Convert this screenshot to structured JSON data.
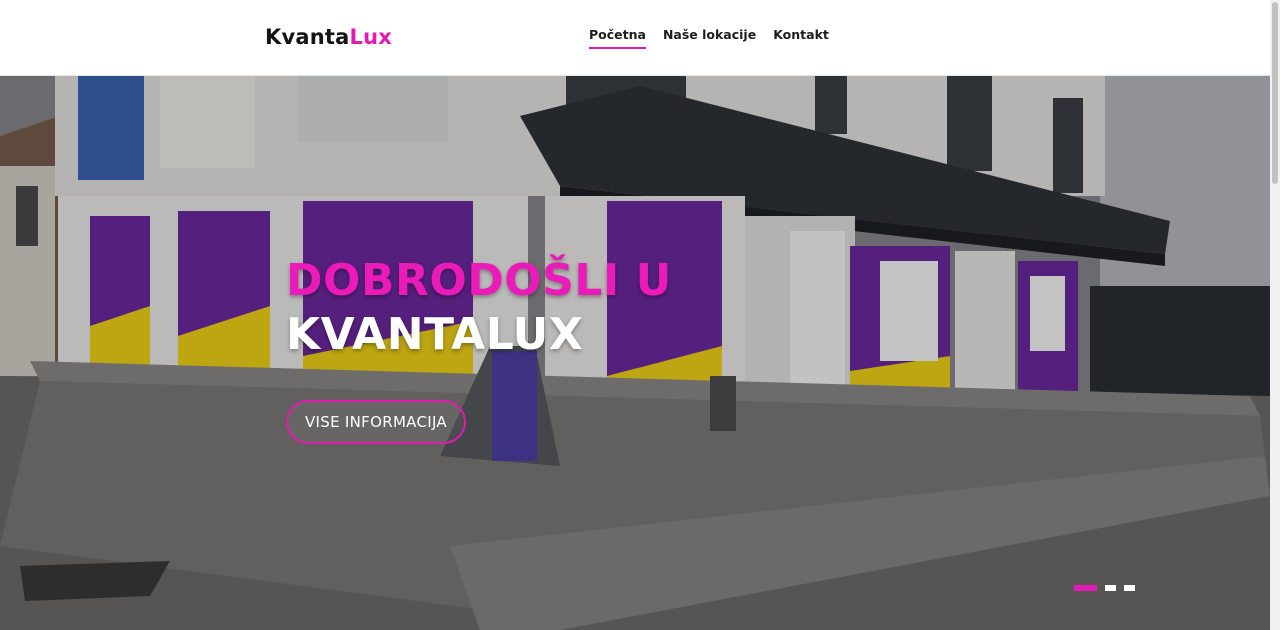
{
  "brand": {
    "name_part1": "Kvanta",
    "name_part2": "Lux",
    "accent_color": "#e11bb3"
  },
  "nav": {
    "items": [
      {
        "label": "Početna",
        "active": true
      },
      {
        "label": "Naše lokacije",
        "active": false
      },
      {
        "label": "Kontakt",
        "active": false
      }
    ]
  },
  "hero": {
    "title_line1": "DOBRODOŠLI U",
    "title_line2": "KVANTALUX",
    "button_label": "VISE INFORMACIJA",
    "slides_total": 3,
    "active_slide": 1
  }
}
